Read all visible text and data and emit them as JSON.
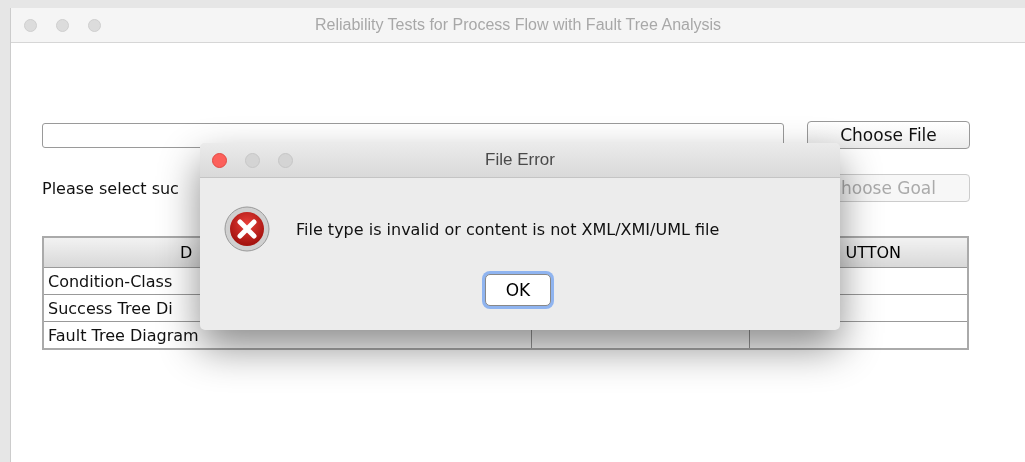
{
  "window": {
    "title": "Reliability Tests for Process Flow with Fault Tree Analysis"
  },
  "choose_file_button": {
    "label": "Choose File",
    "disabled": false
  },
  "goal_label": "Please select suc",
  "choose_goal_button": {
    "label": "hoose Goal",
    "disabled": true
  },
  "table": {
    "header": {
      "column_1": "D",
      "column_3": "UTTON"
    },
    "rows": [
      {
        "column_1": "Condition-Class"
      },
      {
        "column_1": "Success Tree Di"
      },
      {
        "column_1": "Fault Tree Diagram"
      }
    ]
  },
  "dialog": {
    "title": "File Error",
    "message": "File type is invalid or content is not XML/XMI/UML file",
    "button": "OK"
  }
}
